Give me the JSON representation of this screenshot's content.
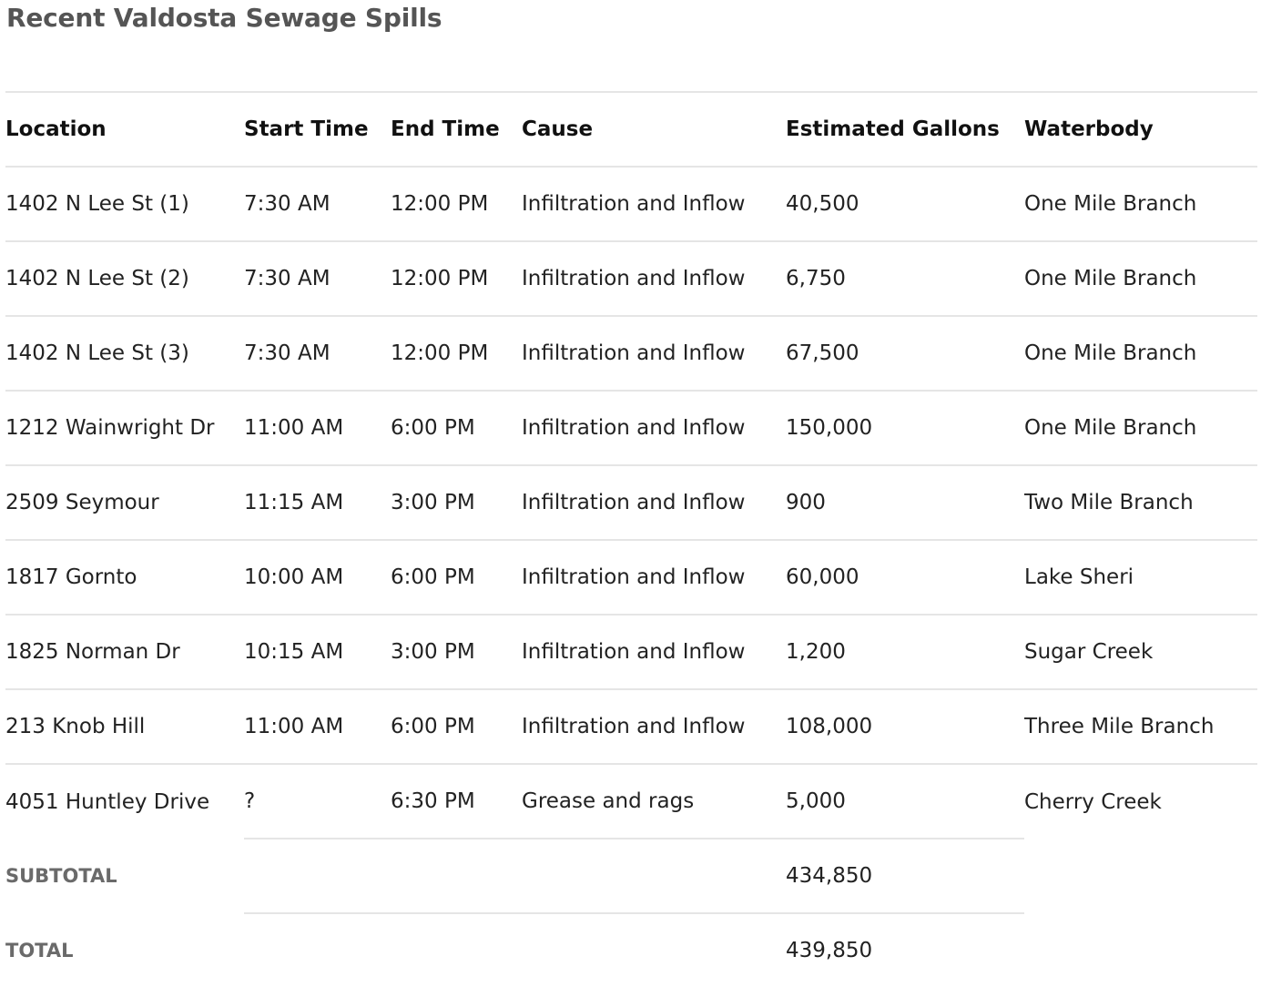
{
  "page": {
    "title": "Recent Valdosta Sewage Spills"
  },
  "table": {
    "headers": [
      "Location",
      "Start Time",
      "End Time",
      "Cause",
      "Estimated Gallons",
      "Waterbody"
    ],
    "rows": [
      [
        "1402 N Lee St (1)",
        "7:30 AM",
        "12:00 PM",
        "Infiltration and Inflow",
        "40,500",
        "One Mile Branch"
      ],
      [
        "1402 N Lee St (2)",
        "7:30 AM",
        "12:00 PM",
        "Infiltration and Inflow",
        "6,750",
        "One Mile Branch"
      ],
      [
        "1402 N Lee St (3)",
        "7:30 AM",
        "12:00 PM",
        "Infiltration and Inflow",
        "67,500",
        "One Mile Branch"
      ],
      [
        "1212 Wainwright Dr",
        "11:00 AM",
        "6:00 PM",
        "Infiltration and Inflow",
        "150,000",
        "One Mile Branch"
      ],
      [
        "2509 Seymour",
        "11:15 AM",
        "3:00 PM",
        "Infiltration and Inflow",
        "900",
        "Two Mile Branch"
      ],
      [
        "1817 Gornto",
        "10:00 AM",
        "6:00 PM",
        "Infiltration and Inflow",
        "60,000",
        "Lake Sheri"
      ],
      [
        "1825 Norman Dr",
        "10:15 AM",
        "3:00 PM",
        "Infiltration and Inflow",
        "1,200",
        "Sugar Creek"
      ],
      [
        "213 Knob Hill",
        "11:00 AM",
        "6:00 PM",
        "Infiltration and Inflow",
        "108,000",
        "Three Mile Branch"
      ],
      [
        "4051 Huntley Drive",
        "?",
        "6:30 PM",
        "Grease and rags",
        "5,000",
        "Cherry Creek"
      ]
    ],
    "subtotal": {
      "label": "SUBTOTAL",
      "gallons": "434,850"
    },
    "total": {
      "label": "TOTAL",
      "gallons": "439,850"
    }
  }
}
